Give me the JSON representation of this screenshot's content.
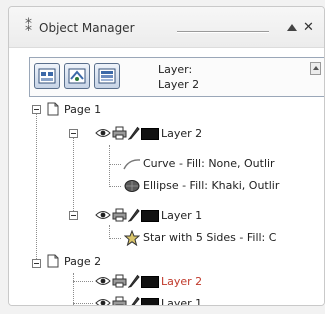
{
  "panel": {
    "title": "Object Manager",
    "current_layer_prefix": "Layer:",
    "current_layer_name": "Layer 2"
  },
  "toolbar": {
    "buttons": [
      "show-object-properties-icon",
      "edit-across-layers-icon",
      "layer-manager-view-icon"
    ]
  },
  "tree": {
    "page1": {
      "label": "Page 1",
      "layer2": {
        "label": "Layer 2",
        "curve": "Curve - Fill: None, Outlir",
        "ellipse": "Ellipse - Fill: Khaki, Outlir"
      },
      "layer1": {
        "label": "Layer 1",
        "star": "Star with 5 Sides - Fill: C"
      }
    },
    "page2": {
      "label": "Page 2",
      "layer2": {
        "label": "Layer 2",
        "color": "#c0392b"
      },
      "layer1": {
        "label": "Layer 1"
      }
    }
  }
}
